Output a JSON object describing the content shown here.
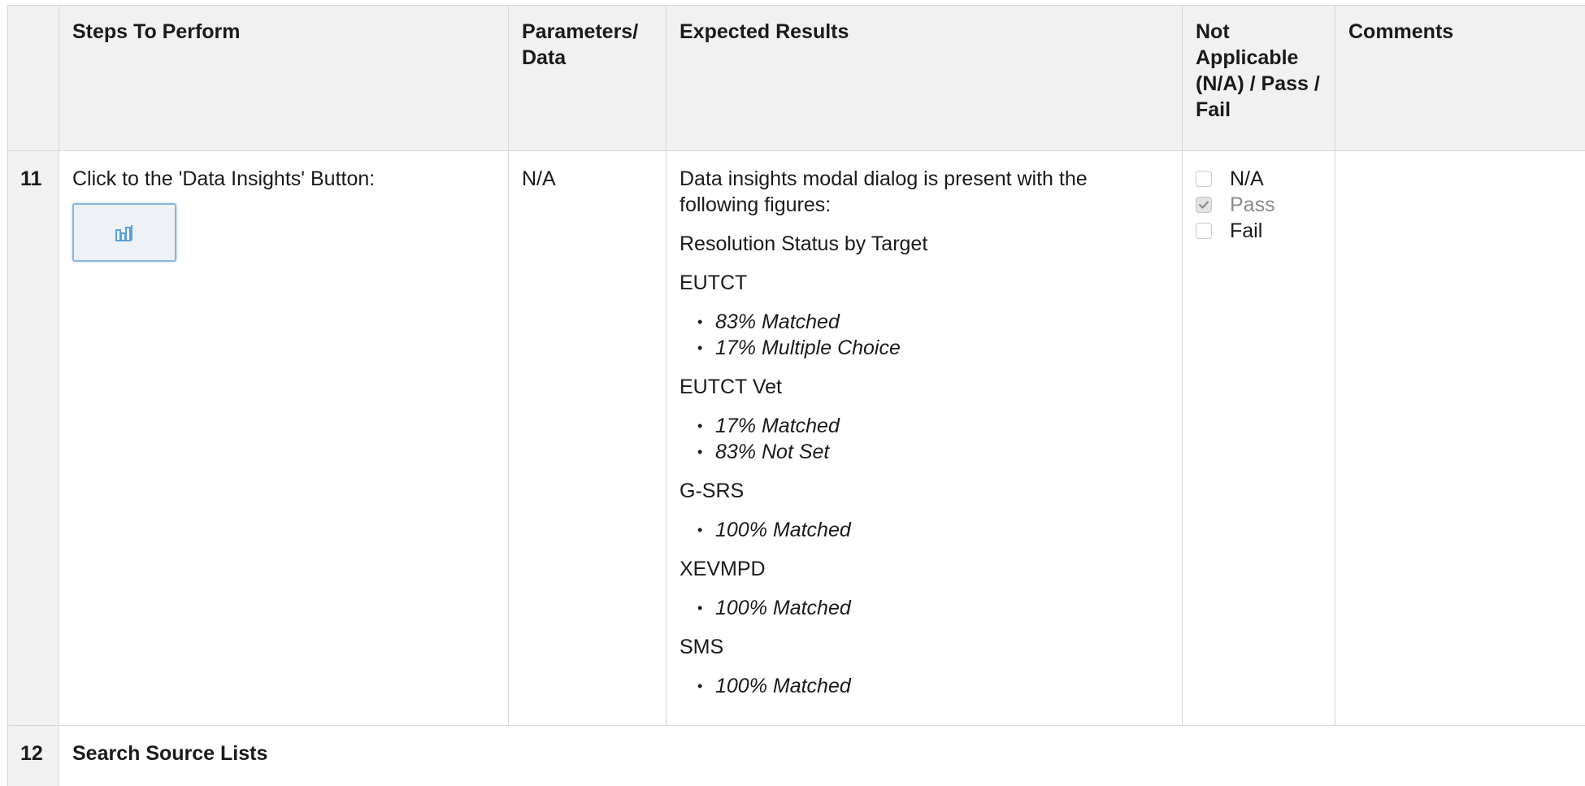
{
  "headers": {
    "steps": "Steps To Perform",
    "params": "Parameters/ Data",
    "expected": "Expected Results",
    "status": "Not Applicable (N/A) / Pass / Fail",
    "comments": "Comments"
  },
  "step": {
    "number": "11",
    "instruction": "Click to the 'Data Insights' Button:",
    "button_icon": "bar-chart-icon",
    "params": "N/A",
    "expected_intro": "Data insights modal dialog is present with the following figures:",
    "subtitle": "Resolution Status by Target",
    "targets": [
      {
        "name": "EUTCT",
        "results": [
          "83% Matched",
          "17% Multiple Choice"
        ]
      },
      {
        "name": "EUTCT Vet",
        "results": [
          "17% Matched",
          "83% Not Set"
        ]
      },
      {
        "name": "G-SRS",
        "results": [
          "100% Matched"
        ]
      },
      {
        "name": "XEVMPD",
        "results": [
          "100% Matched"
        ]
      },
      {
        "name": "SMS",
        "results": [
          "100% Matched"
        ]
      }
    ],
    "status_options": [
      {
        "label": "N/A",
        "checked": false
      },
      {
        "label": "Pass",
        "checked": true
      },
      {
        "label": "Fail",
        "checked": false
      }
    ],
    "comments": ""
  },
  "next_step": {
    "number": "12",
    "title": "Search Source Lists"
  },
  "colors": {
    "header_bg": "#f1f1f1",
    "border": "#d8d8d8",
    "button_border": "#87b6dc",
    "icon_blue": "#5aa0d8"
  }
}
